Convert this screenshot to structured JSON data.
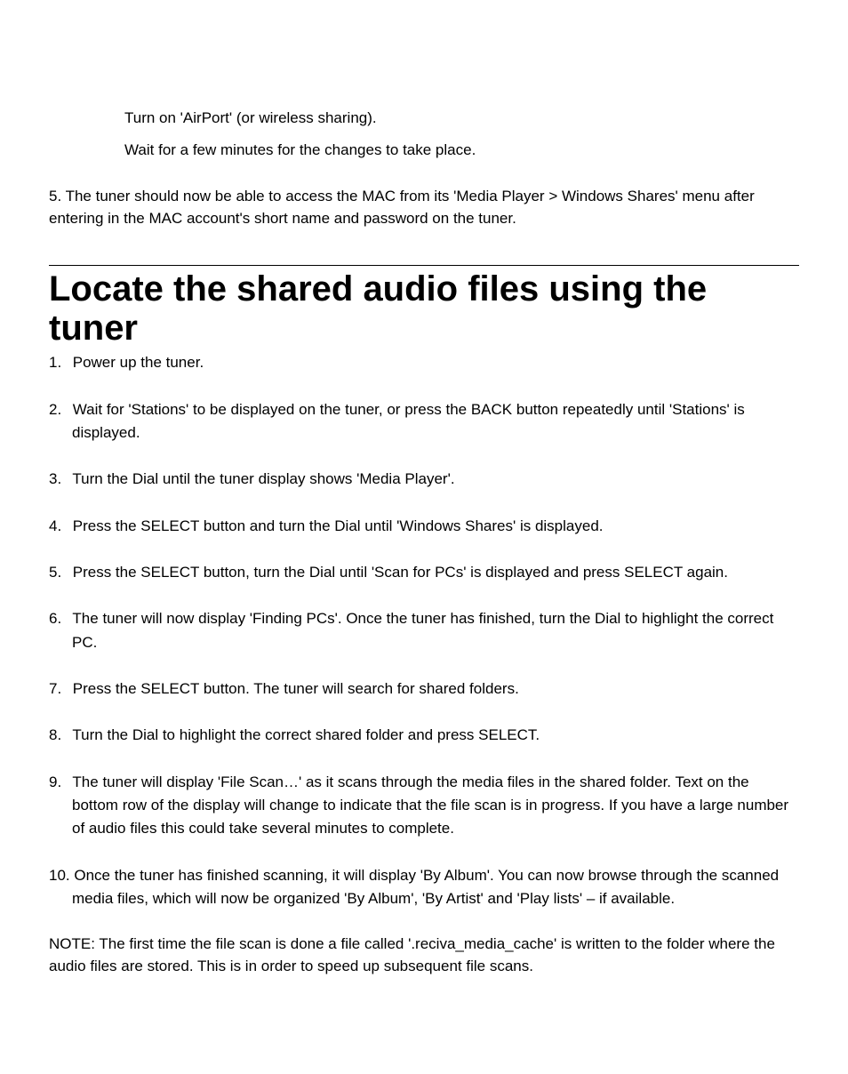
{
  "intro": {
    "lines": [
      "Turn on 'AirPort' (or wireless sharing).",
      "Wait for a few minutes for the changes to take place."
    ],
    "para": "5. The tuner should now be able to access the MAC from its 'Media Player > Windows Shares' menu after entering in the MAC account's short name and password on the tuner."
  },
  "section": {
    "title": "Locate the shared audio files using the tuner",
    "steps": [
      "Power up the tuner.",
      "Wait for 'Stations' to be displayed on the tuner, or press the BACK button repeatedly until 'Stations' is displayed.",
      "Turn the Dial until the tuner display shows 'Media Player'.",
      "Press the SELECT button and turn the Dial until  'Windows Shares' is displayed.",
      "Press the SELECT button, turn the Dial until 'Scan for PCs' is displayed and press SELECT again.",
      "The tuner will now display 'Finding PCs'. Once the tuner has finished, turn the Dial to highlight the correct PC.",
      "Press the SELECT button. The tuner will search for shared folders.",
      "Turn the Dial to highlight the correct shared folder and press SELECT.",
      "The tuner will display 'File Scan…' as it scans through the media files in the shared folder. Text on the bottom row of the display will change to indicate that the file scan is in progress. If you have a large number of audio files this could take several minutes to complete.",
      "Once the tuner has finished scanning, it will display 'By Album'. You can now browse through the scanned media files, which will now be organized 'By Album', 'By Artist' and 'Play lists' – if available."
    ],
    "note": "NOTE: The first time the file scan is done a file called '.reciva_media_cache' is written to the folder where the audio files are stored. This is in order to speed up subsequent file scans."
  }
}
